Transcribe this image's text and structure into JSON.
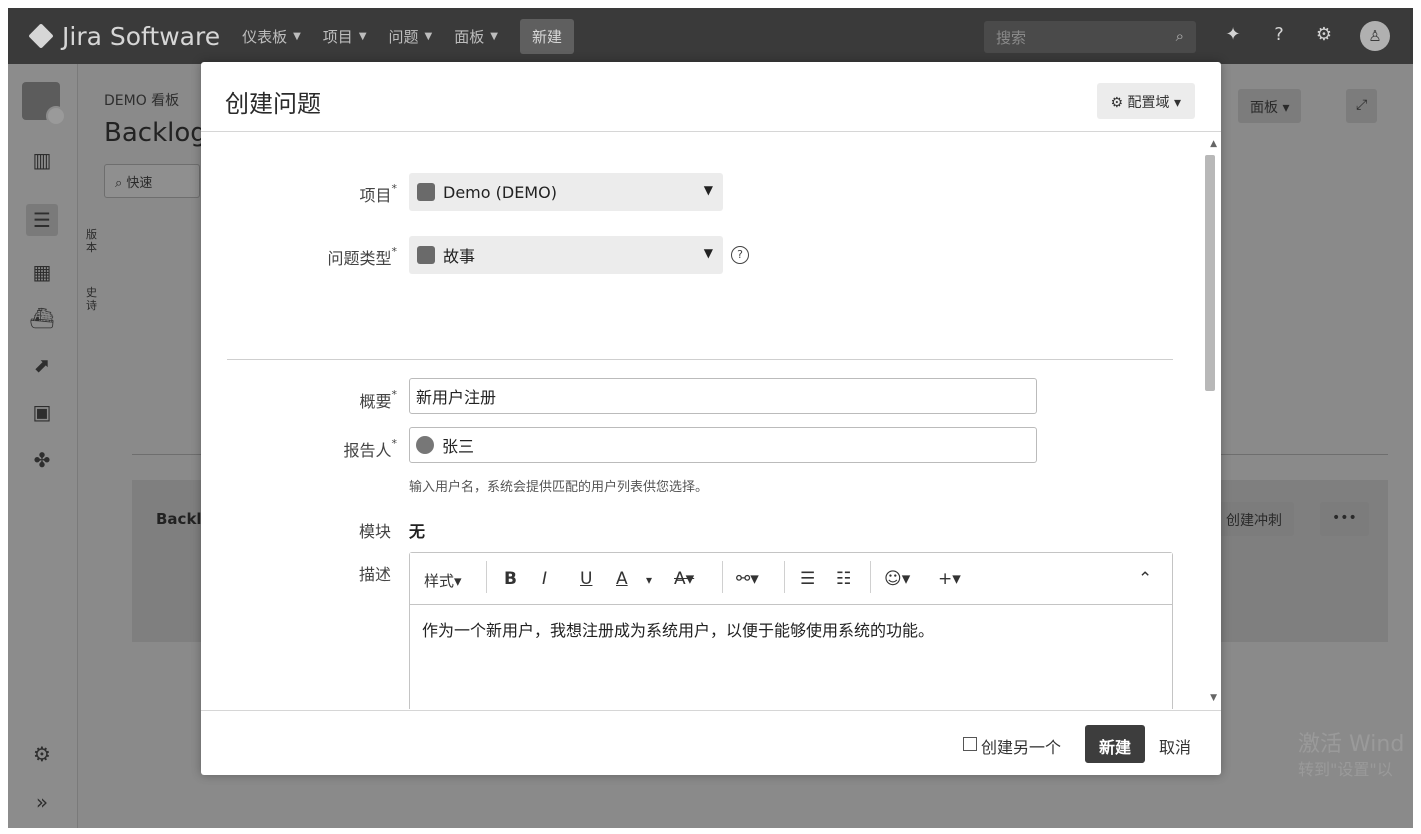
{
  "topbar": {
    "logo": "Jira Software",
    "nav": [
      "仪表板",
      "项目",
      "问题",
      "面板"
    ],
    "create": "新建",
    "search_placeholder": "搜索"
  },
  "background": {
    "breadcrumb": "DEMO 看板",
    "title": "Backlog",
    "quick": "快速",
    "vertical_1": "版本",
    "vertical_2": "史诗",
    "board_btn": "面板",
    "panel_label": "Backl",
    "create_sprint": "创建冲刺",
    "more": "•••",
    "watermark_1": "激活 Wind",
    "watermark_2": "转到\"设置\"以"
  },
  "modal": {
    "title": "创建问题",
    "config": "配置域",
    "project_label": "项目",
    "project_value": "Demo (DEMO)",
    "type_label": "问题类型",
    "type_value": "故事",
    "summary_label": "概要",
    "summary_value": "新用户注册",
    "reporter_label": "报告人",
    "reporter_value": "张三",
    "reporter_hint": "输入用户名，系统会提供匹配的用户列表供您选择。",
    "component_label": "模块",
    "component_value": "无",
    "desc_label": "描述",
    "style_label": "样式",
    "desc_text": "作为一个新用户，我想注册成为系统用户，以便于能够使用系统的功能。",
    "create_another": "创建另一个",
    "submit": "新建",
    "cancel": "取消",
    "required_mark": "*"
  }
}
